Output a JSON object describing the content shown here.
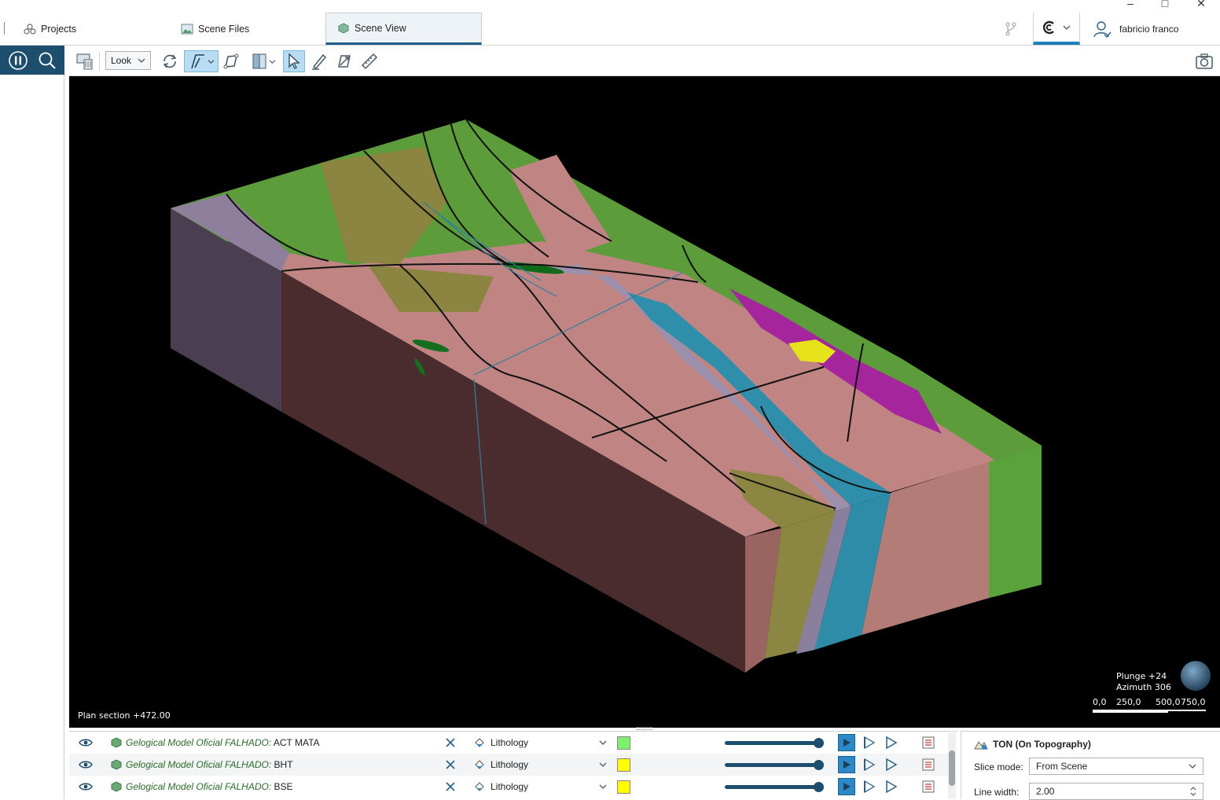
{
  "window": {
    "minimize": "–",
    "maximize": "□",
    "close": "✕"
  },
  "tabs": [
    {
      "label": "Projects",
      "icon": "projects-icon"
    },
    {
      "label": "Scene Files",
      "icon": "scene-files-icon"
    },
    {
      "label": "Scene View",
      "icon": "scene-view-icon",
      "active": true
    }
  ],
  "header": {
    "user_name": "fabricio franco",
    "brand_icon": "cloud-logo-icon",
    "branch_icon": "branch-icon"
  },
  "toolbar": {
    "mode_select": "Look",
    "icons": [
      "trash-screen-icon",
      "rotate-icon",
      "draw-line-icon",
      "polyline-icon",
      "slice-icon",
      "select-arrow-icon",
      "pen-icon",
      "transform-icon",
      "ruler-icon",
      "camera-icon"
    ]
  },
  "viewport": {
    "plan_section": "Plan section +472.00",
    "plunge": "Plunge +24",
    "azimuth": "Azimuth 306",
    "scale_ticks": [
      "0,0",
      "250,0",
      "500,0",
      "750,0"
    ],
    "background": "#000000"
  },
  "objects": [
    {
      "name": "Gelogical Model Oficial FALHADO:",
      "suffix": " ACT MATA",
      "colour_by": "Lithology",
      "swatch": "#7ef06e"
    },
    {
      "name": "Gelogical Model Oficial FALHADO:",
      "suffix": " BHT",
      "colour_by": "Lithology",
      "swatch": "#ffff00"
    },
    {
      "name": "Gelogical Model Oficial FALHADO:",
      "suffix": " BSE",
      "colour_by": "Lithology",
      "swatch": "#ffff00"
    }
  ],
  "props": {
    "title": "TON (On Topography)",
    "slice_mode_label": "Slice mode:",
    "slice_mode_value": "From Scene",
    "line_width_label": "Line width:",
    "line_width_value": "2.00"
  },
  "colors": {
    "accent": "#1d4e6e",
    "tab_underline": "#1f5f86",
    "selected_tool": "#b9dcf2"
  }
}
